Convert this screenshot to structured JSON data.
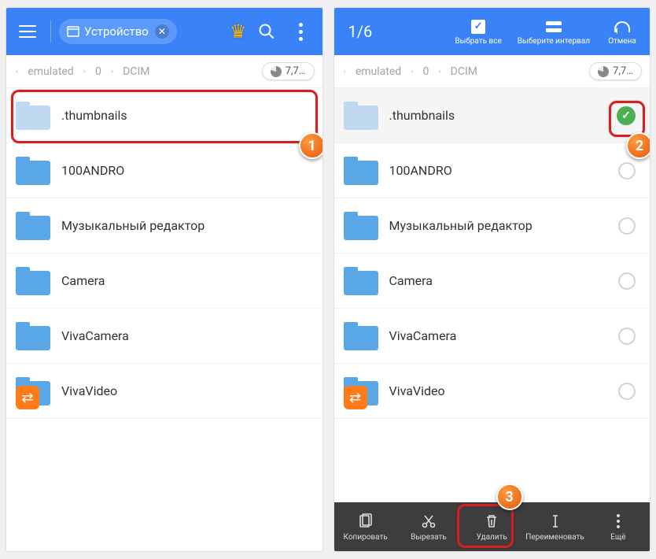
{
  "left": {
    "chip_label": "Устройство",
    "breadcrumb": [
      "emulated",
      "0",
      "DCIM"
    ],
    "storage_badge": "7,7…",
    "folders": [
      {
        "name": ".thumbnails",
        "muted": true
      },
      {
        "name": "100ANDRO",
        "muted": false
      },
      {
        "name": "Музыкальный редактор",
        "muted": false
      },
      {
        "name": "Camera",
        "muted": false
      },
      {
        "name": "VivaCamera",
        "muted": false
      },
      {
        "name": "VivaVideo",
        "muted": false
      }
    ],
    "callout": "1"
  },
  "right": {
    "selection_count": "1/6",
    "top_actions": {
      "select_all": "Выбрать все",
      "interval": "Выберите интервал",
      "cancel": "Отмена"
    },
    "breadcrumb": [
      "emulated",
      "0",
      "DCIM"
    ],
    "storage_badge": "7,7…",
    "folders": [
      {
        "name": ".thumbnails",
        "muted": true,
        "selected": true
      },
      {
        "name": "100ANDRO",
        "muted": false,
        "selected": false
      },
      {
        "name": "Музыкальный редактор",
        "muted": false,
        "selected": false
      },
      {
        "name": "Camera",
        "muted": false,
        "selected": false
      },
      {
        "name": "VivaCamera",
        "muted": false,
        "selected": false
      },
      {
        "name": "VivaVideo",
        "muted": false,
        "selected": false
      }
    ],
    "bottom_actions": {
      "copy": "Копировать",
      "cut": "Вырезать",
      "delete": "Удалить",
      "rename": "Переименовать",
      "more": "Ещё"
    },
    "callout_check": "2",
    "callout_delete": "3"
  }
}
